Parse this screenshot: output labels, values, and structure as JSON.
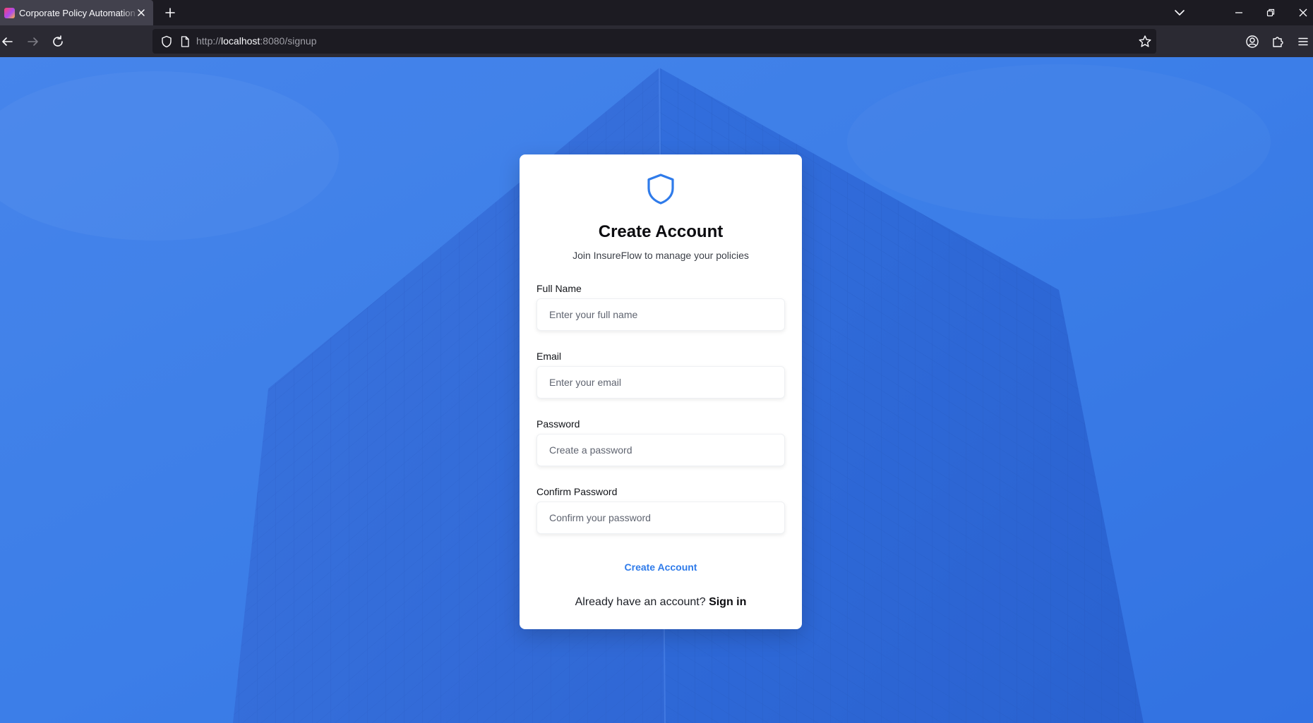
{
  "browser": {
    "tab_title": "Corporate Policy Automation App",
    "url_prefix": "http://",
    "url_host": "localhost",
    "url_rest": ":8080/signup"
  },
  "signup": {
    "title": "Create Account",
    "subtitle": "Join InsureFlow to manage your policies",
    "fields": [
      {
        "label": "Full Name",
        "placeholder": "Enter your full name"
      },
      {
        "label": "Email",
        "placeholder": "Enter your email"
      },
      {
        "label": "Password",
        "placeholder": "Create a password"
      },
      {
        "label": "Confirm Password",
        "placeholder": "Confirm your password"
      }
    ],
    "submit_label": "Create Account",
    "signin_prompt": "Already have an account?",
    "signin_link": "Sign in"
  },
  "colors": {
    "accent": "#2f7bea",
    "background": "#3a7de8",
    "card": "#ffffff",
    "browser_dark": "#1c1b22",
    "browser_nav": "#2b2a33"
  },
  "icons": {
    "logo": "shield-icon",
    "tab_favicon": "app-favicon-icon",
    "tab_close": "close-icon",
    "new_tab": "plus-icon",
    "back": "arrow-left-icon",
    "forward": "arrow-right-icon",
    "reload": "reload-icon",
    "tracking": "shield-outline-icon",
    "page": "page-icon",
    "bookmark": "star-icon",
    "account": "account-icon",
    "extensions": "puzzle-icon",
    "menu": "hamburger-menu-icon",
    "list_tabs": "chevron-down-icon",
    "minimize": "minimize-icon",
    "restore": "restore-icon",
    "close_window": "close-window-icon"
  }
}
